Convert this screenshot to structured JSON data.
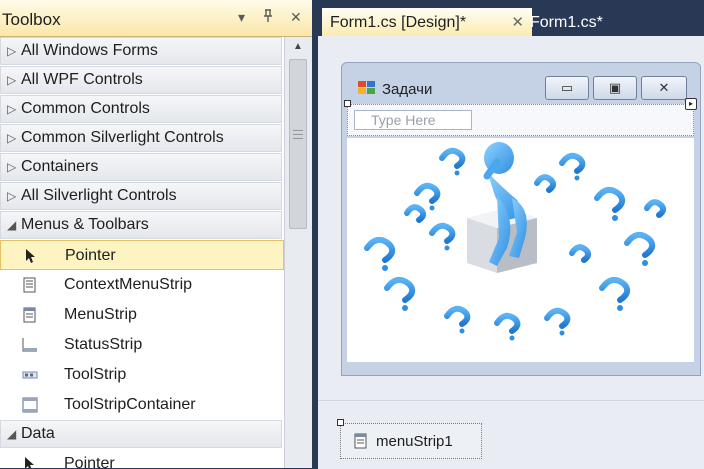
{
  "toolbox": {
    "title": "Toolbox",
    "categories": [
      {
        "label": "All Windows Forms",
        "expanded": false
      },
      {
        "label": "All WPF Controls",
        "expanded": false
      },
      {
        "label": "Common Controls",
        "expanded": false
      },
      {
        "label": "Common Silverlight Controls",
        "expanded": false
      },
      {
        "label": "Containers",
        "expanded": false
      },
      {
        "label": "All Silverlight Controls",
        "expanded": false
      },
      {
        "label": "Menus & Toolbars",
        "expanded": true
      },
      {
        "label": "Data",
        "expanded": true
      }
    ],
    "menus_items": [
      {
        "label": "Pointer",
        "icon": "pointer-icon",
        "selected": true
      },
      {
        "label": "ContextMenuStrip",
        "icon": "context-menu-strip-icon",
        "selected": false
      },
      {
        "label": "MenuStrip",
        "icon": "menu-strip-icon",
        "selected": false
      },
      {
        "label": "StatusStrip",
        "icon": "status-strip-icon",
        "selected": false
      },
      {
        "label": "ToolStrip",
        "icon": "tool-strip-icon",
        "selected": false
      },
      {
        "label": "ToolStripContainer",
        "icon": "tool-strip-container-icon",
        "selected": false
      }
    ],
    "data_items": [
      {
        "label": "Pointer",
        "icon": "pointer-icon",
        "selected": false
      }
    ]
  },
  "tabs": [
    {
      "label": "Form1.cs [Design]*",
      "active": true
    },
    {
      "label": "Form1.cs*",
      "active": false
    }
  ],
  "form": {
    "title": "Задачи",
    "menu_placeholder": "Type Here"
  },
  "tray": {
    "component": "menuStrip1"
  },
  "colors": {
    "vs_dark": "#293955",
    "tab_active": "#fbeaa9",
    "selection": "#fdf4c1",
    "question_blue": "#2e8fe0"
  }
}
